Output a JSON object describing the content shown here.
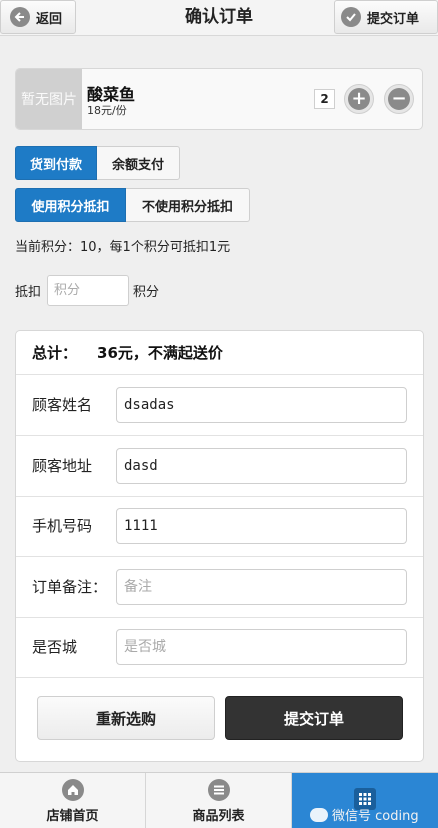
{
  "header": {
    "back_label": "返回",
    "title": "确认订单",
    "submit_label": "提交订单"
  },
  "product": {
    "thumb_text": "暂无图片",
    "name": "酸菜鱼",
    "price": "18元/份",
    "quantity": "2",
    "plus_glyph": "+",
    "minus_glyph": "−"
  },
  "payment": {
    "options": [
      "货到付款",
      "余额支付"
    ],
    "selected": "货到付款"
  },
  "points_mode": {
    "options": [
      "使用积分抵扣",
      "不使用积分抵扣"
    ],
    "selected": "使用积分抵扣"
  },
  "points_info": "当前积分：10，每1个积分可抵扣1元",
  "deduct": {
    "label": "抵扣",
    "placeholder": "积分",
    "unit": "积分"
  },
  "order": {
    "total_label": "总计：",
    "total_value": "36元，不满起送价",
    "fields": [
      {
        "label": "顾客姓名",
        "value": "dsadas",
        "placeholder": ""
      },
      {
        "label": "顾客地址",
        "value": "dasd",
        "placeholder": ""
      },
      {
        "label": "手机号码",
        "value": "1111",
        "placeholder": ""
      },
      {
        "label": "订单备注：",
        "value": "",
        "placeholder": "备注"
      },
      {
        "label": "是否城",
        "value": "",
        "placeholder": "是否城"
      }
    ],
    "reselect_label": "重新选购",
    "submit_label": "提交订单"
  },
  "footer": {
    "tabs": [
      {
        "label": "店铺首页",
        "icon": "home-icon"
      },
      {
        "label": "商品列表",
        "icon": "list-icon"
      },
      {
        "label": "",
        "icon": "grid-icon"
      }
    ],
    "active_index": 2
  },
  "watermark": "微信号 coding",
  "colors": {
    "accent": "#1e7bc6",
    "footer_active": "#2b86d4",
    "submit_button": "#333333"
  }
}
